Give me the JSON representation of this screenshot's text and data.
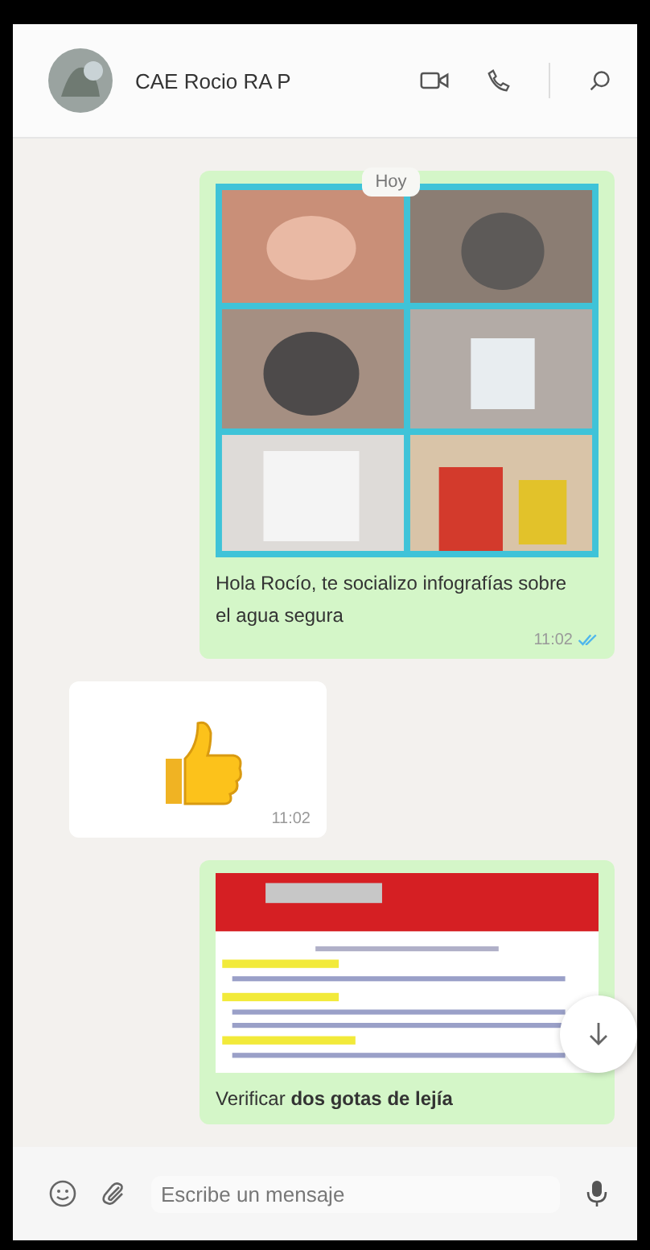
{
  "header": {
    "contact_name": "CAE Rocio RA P"
  },
  "date_badge": "Hoy",
  "messages": [
    {
      "outgoing": true,
      "caption": "Hola Rocío, te socializo infografías sobre el agua segura",
      "time": "11:02",
      "read": true
    },
    {
      "kind": "sticker",
      "outgoing": false,
      "time": "11:02"
    },
    {
      "kind": "document",
      "outgoing": true,
      "caption": "Verificar **dos gotas de lejía**"
    }
  ],
  "composer": {
    "placeholder": "Escribe un mensaje"
  }
}
